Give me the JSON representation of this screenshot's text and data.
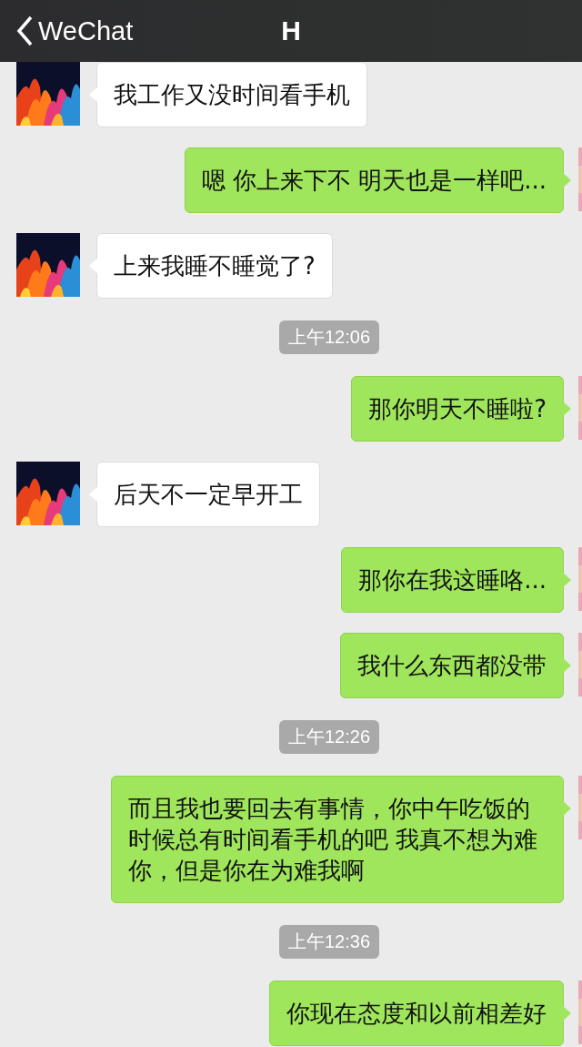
{
  "header": {
    "back_label": "WeChat",
    "title": "H"
  },
  "messages": [
    {
      "kind": "left",
      "text": "我工作又没时间看手机"
    },
    {
      "kind": "right",
      "text": "嗯 你上来下不 明天也是一样吧..."
    },
    {
      "kind": "left",
      "text": "上来我睡不睡觉了?"
    },
    {
      "kind": "time",
      "text": "上午12:06"
    },
    {
      "kind": "right",
      "text": "那你明天不睡啦?"
    },
    {
      "kind": "left",
      "text": "后天不一定早开工"
    },
    {
      "kind": "right",
      "text": "那你在我这睡咯..."
    },
    {
      "kind": "right",
      "text": "我什么东西都没带"
    },
    {
      "kind": "time",
      "text": "上午12:26"
    },
    {
      "kind": "right",
      "text": "而且我也要回去有事情，你中午吃饭的时候总有时间看手机的吧 我真不想为难你，但是你在为难我啊"
    },
    {
      "kind": "time",
      "text": "上午12:36"
    },
    {
      "kind": "right",
      "text": "你现在态度和以前相差好"
    }
  ]
}
